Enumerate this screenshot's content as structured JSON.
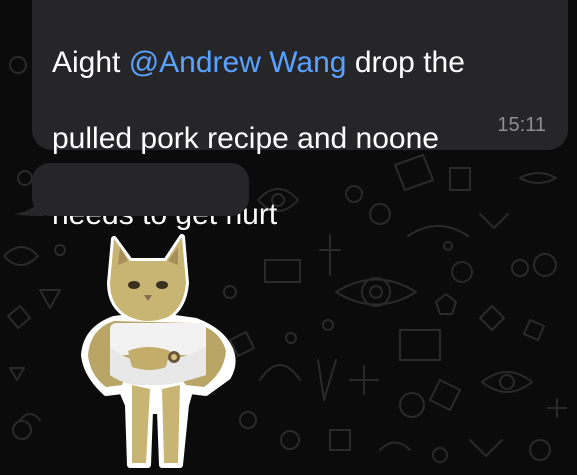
{
  "message": {
    "prefix": "Aight ",
    "mention": "@Andrew Wang",
    "line1_suffix": "  drop the",
    "line2": "pulled pork recipe and noone",
    "line3": "needs to get hurt",
    "time": "15:11"
  },
  "colors": {
    "background": "#0b0b0b",
    "bubble": "#262628",
    "mention": "#5aa2ff",
    "timestamp": "#8e8e93"
  },
  "sticker": {
    "icon": "cat-muscle-sticker-icon"
  }
}
